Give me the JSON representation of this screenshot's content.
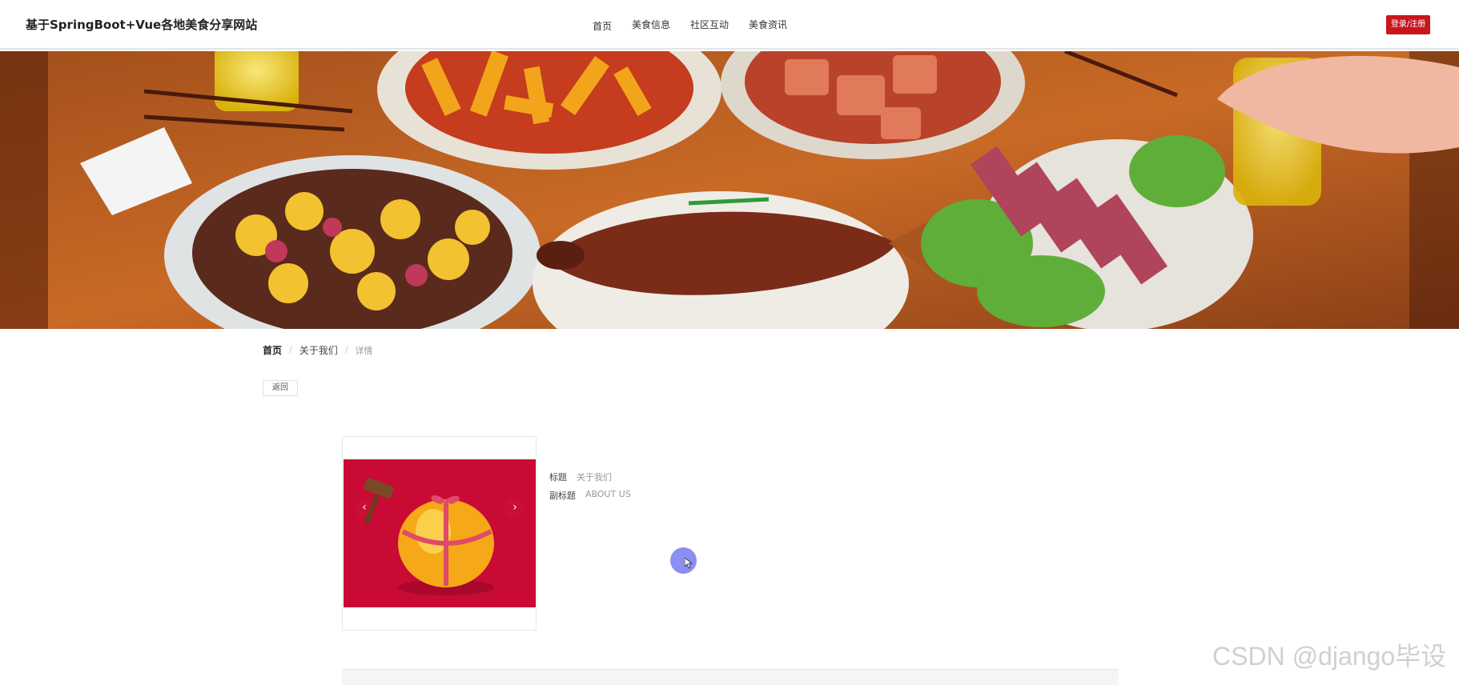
{
  "header": {
    "site_title": "基于SpringBoot+Vue各地美食分享网站",
    "nav": [
      "首页",
      "美食信息",
      "社区互动",
      "美食资讯"
    ],
    "login_label": "登录/注册"
  },
  "breadcrumb": {
    "home": "首页",
    "separator": "/",
    "about": "关于我们",
    "current": "详情"
  },
  "back_button": "返回",
  "detail": {
    "fields": [
      {
        "label": "标题",
        "value": "关于我们"
      },
      {
        "label": "副标题",
        "value": "ABOUT US"
      }
    ],
    "carousel": {
      "prev": "‹",
      "next": "›"
    }
  },
  "watermark": "CSDN @django毕设",
  "colors": {
    "accent": "#c8161d",
    "carousel_bg": "#c90a35"
  }
}
